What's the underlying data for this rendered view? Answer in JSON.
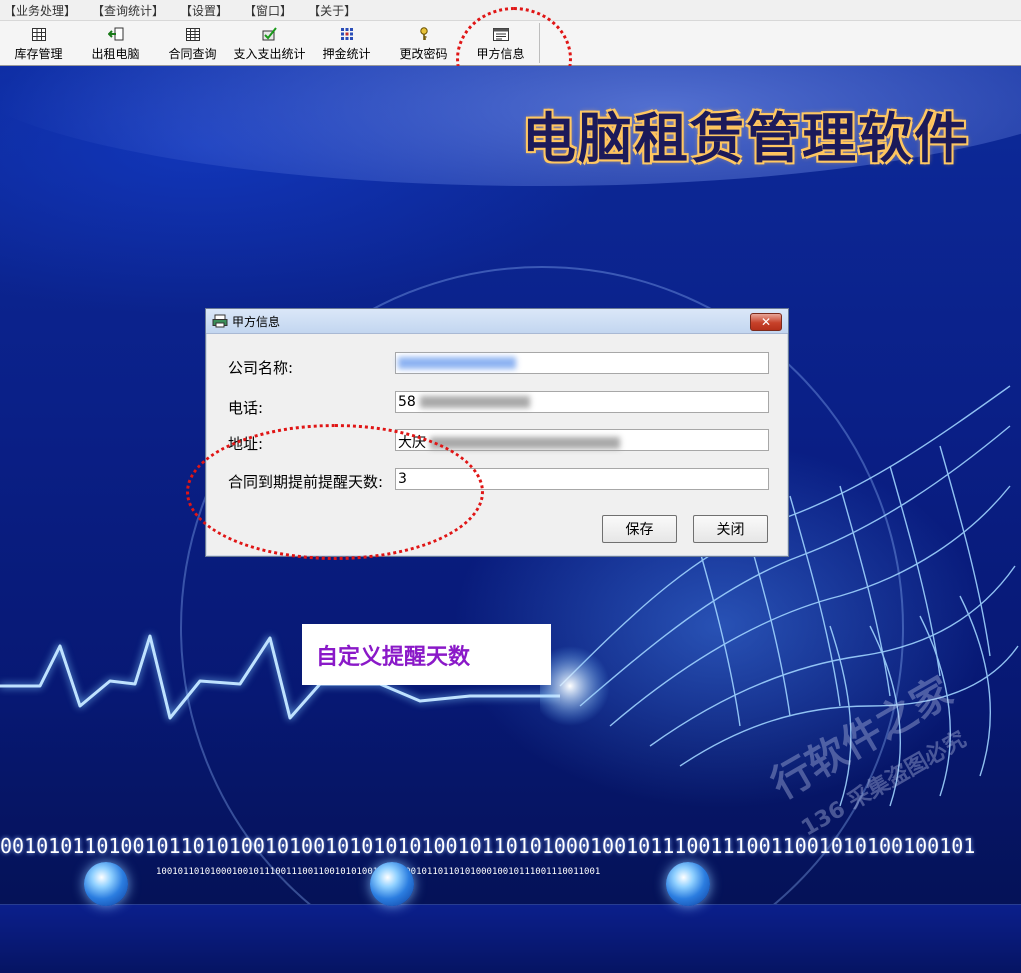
{
  "menubar": {
    "items": [
      "【业务处理】",
      "【查询统计】",
      "【设置】",
      "【窗口】",
      "【关于】"
    ]
  },
  "toolbar": {
    "buttons": [
      {
        "label": "库存管理",
        "icon": "inventory-grid-icon"
      },
      {
        "label": "出租电脑",
        "icon": "rent-out-icon"
      },
      {
        "label": "合同查询",
        "icon": "contract-query-icon"
      },
      {
        "label": "支入支出统计",
        "icon": "income-expense-icon"
      },
      {
        "label": "押金统计",
        "icon": "deposit-stats-icon"
      },
      {
        "label": "更改密码",
        "icon": "key-icon"
      },
      {
        "label": "甲方信息",
        "icon": "party-info-icon"
      }
    ]
  },
  "background": {
    "title": "电脑租赁管理软件",
    "binary_line1": "001010110100101101010010100101010101001011010100010010111001110011001010100100101",
    "binary_line2": "1001011010100010010111001110011001010100100101001011011010100010010111001110011001"
  },
  "dialog": {
    "title": "甲方信息",
    "close_glyph": "✕",
    "fields": {
      "company": {
        "label": "公司名称:",
        "value": ""
      },
      "phone": {
        "label": "电话:",
        "value": "58"
      },
      "address": {
        "label": "地址:",
        "value": "大庆"
      },
      "remind_days": {
        "label": "合同到期提前提醒天数:",
        "value": "3"
      }
    },
    "save_label": "保存",
    "close_label": "关闭"
  },
  "annotation": {
    "callout_text": "自定义提醒天数"
  },
  "colors": {
    "callout_text": "#8a19c8",
    "annotation_ring": "#e01515",
    "desktop_blue": "#0a1f86"
  }
}
